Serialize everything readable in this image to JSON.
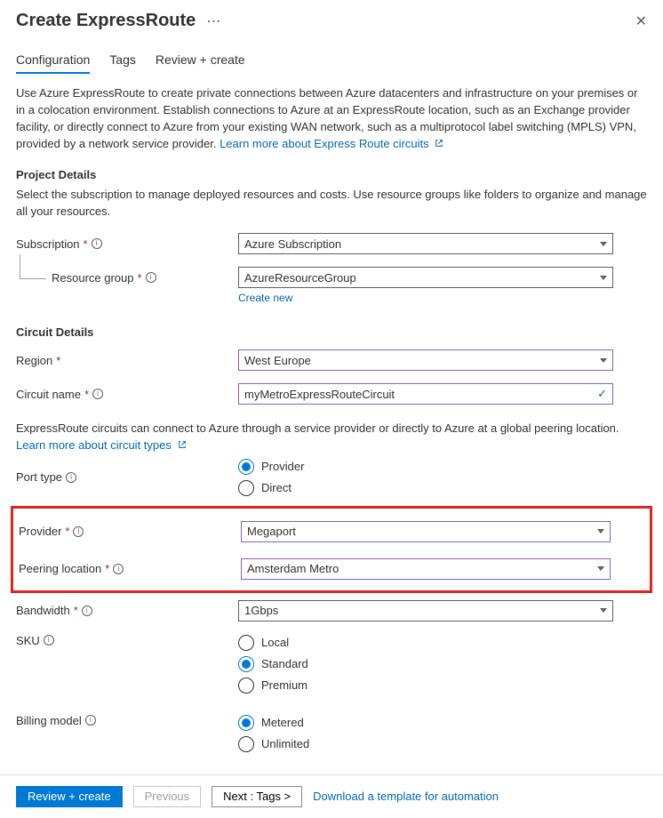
{
  "header": {
    "title": "Create ExpressRoute"
  },
  "tabs": {
    "configuration": "Configuration",
    "tags": "Tags",
    "review": "Review + create"
  },
  "intro": {
    "text": "Use Azure ExpressRoute to create private connections between Azure datacenters and infrastructure on your premises or in a colocation environment. Establish connections to Azure at an ExpressRoute location, such as an Exchange provider facility, or directly connect to Azure from your existing WAN network, such as a multiprotocol label switching (MPLS) VPN, provided by a network service provider. ",
    "link": "Learn more about Express Route circuits"
  },
  "project": {
    "heading": "Project Details",
    "desc": "Select the subscription to manage deployed resources and costs. Use resource groups like folders to organize and manage all your resources.",
    "subscription_label": "Subscription",
    "subscription_value": "Azure Subscription",
    "rg_label": "Resource group",
    "rg_value": "AzureResourceGroup",
    "create_new": "Create new"
  },
  "circuit": {
    "heading": "Circuit Details",
    "region_label": "Region",
    "region_value": "West Europe",
    "name_label": "Circuit name",
    "name_value": "myMetroExpressRouteCircuit",
    "desc": "ExpressRoute circuits can connect to Azure through a service provider or directly to Azure at a global peering location.",
    "learn": "Learn more about circuit types",
    "port_label": "Port type",
    "port_provider": "Provider",
    "port_direct": "Direct",
    "provider_label": "Provider",
    "provider_value": "Megaport",
    "peering_label": "Peering location",
    "peering_value": "Amsterdam Metro",
    "bandwidth_label": "Bandwidth",
    "bandwidth_value": "1Gbps",
    "sku_label": "SKU",
    "sku_local": "Local",
    "sku_standard": "Standard",
    "sku_premium": "Premium",
    "billing_label": "Billing model",
    "billing_metered": "Metered",
    "billing_unlimited": "Unlimited"
  },
  "footer": {
    "review": "Review + create",
    "previous": "Previous",
    "next": "Next : Tags >",
    "download": "Download a template for automation"
  }
}
